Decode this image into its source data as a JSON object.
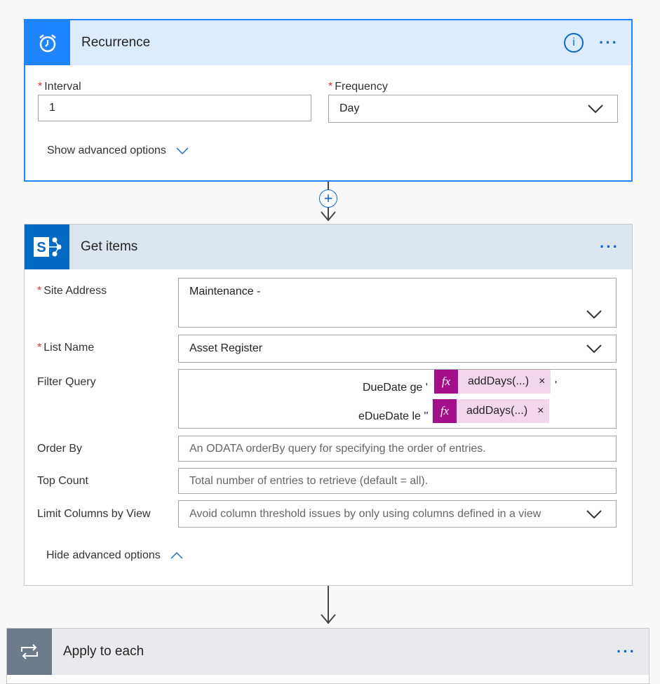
{
  "recurrence": {
    "title": "Recurrence",
    "icon": "alarm-clock-icon",
    "accent": "#1f85ff",
    "interval": {
      "label": "Interval",
      "value": "1"
    },
    "frequency": {
      "label": "Frequency",
      "value": "Day"
    },
    "advanced": "Show advanced options"
  },
  "get_items": {
    "title": "Get items",
    "icon": "sharepoint-icon",
    "accent": "#036ac4",
    "site_address": {
      "label": "Site Address",
      "value": "Maintenance -"
    },
    "list_name": {
      "label": "List Name",
      "value": "Asset Register"
    },
    "filter_query": {
      "label": "Filter Query",
      "line1": "DueDate ge '",
      "line2": "eDueDate le ''",
      "token1": "addDays(...)",
      "token2": "addDays(...)",
      "trail1": "'"
    },
    "order_by": {
      "label": "Order By",
      "placeholder": "An ODATA orderBy query for specifying the order of entries."
    },
    "top_count": {
      "label": "Top Count",
      "placeholder": "Total number of entries to retrieve (default = all)."
    },
    "limit_columns": {
      "label": "Limit Columns by View",
      "placeholder": "Avoid column threshold issues by only using columns defined in a view"
    },
    "advanced": "Hide advanced options"
  },
  "apply_each": {
    "title": "Apply to each",
    "icon": "loop-icon"
  },
  "token_color": "#a30e8a"
}
